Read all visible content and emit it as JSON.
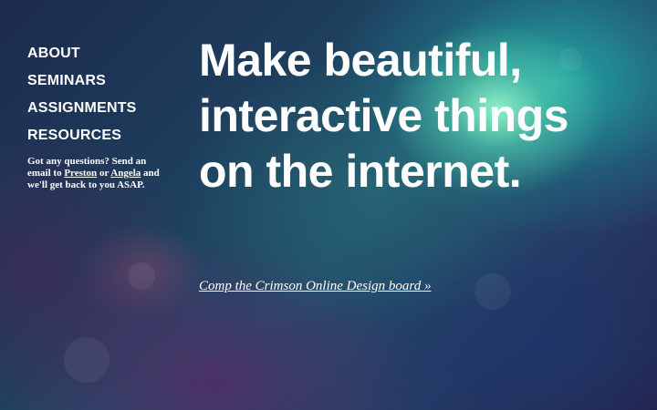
{
  "nav": {
    "items": [
      {
        "label": "ABOUT"
      },
      {
        "label": "SEMINARS"
      },
      {
        "label": "ASSIGNMENTS"
      },
      {
        "label": "RESOURCES"
      }
    ]
  },
  "contact": {
    "prefix": "Got any questions? Send an email to ",
    "link1": "Preston",
    "middle": " or ",
    "link2": "Angela",
    "suffix": " and we'll get back to you ASAP."
  },
  "hero": {
    "headline": "Make beautiful, interactive things on the internet.",
    "cta": "Comp the Crimson Online Design board »"
  },
  "colors": {
    "text": "#ffffff",
    "bg_teal": "#23afaa",
    "bg_glow": "#96f5c8",
    "bg_navy": "#1c2a4e",
    "bg_purple": "#50285f"
  }
}
